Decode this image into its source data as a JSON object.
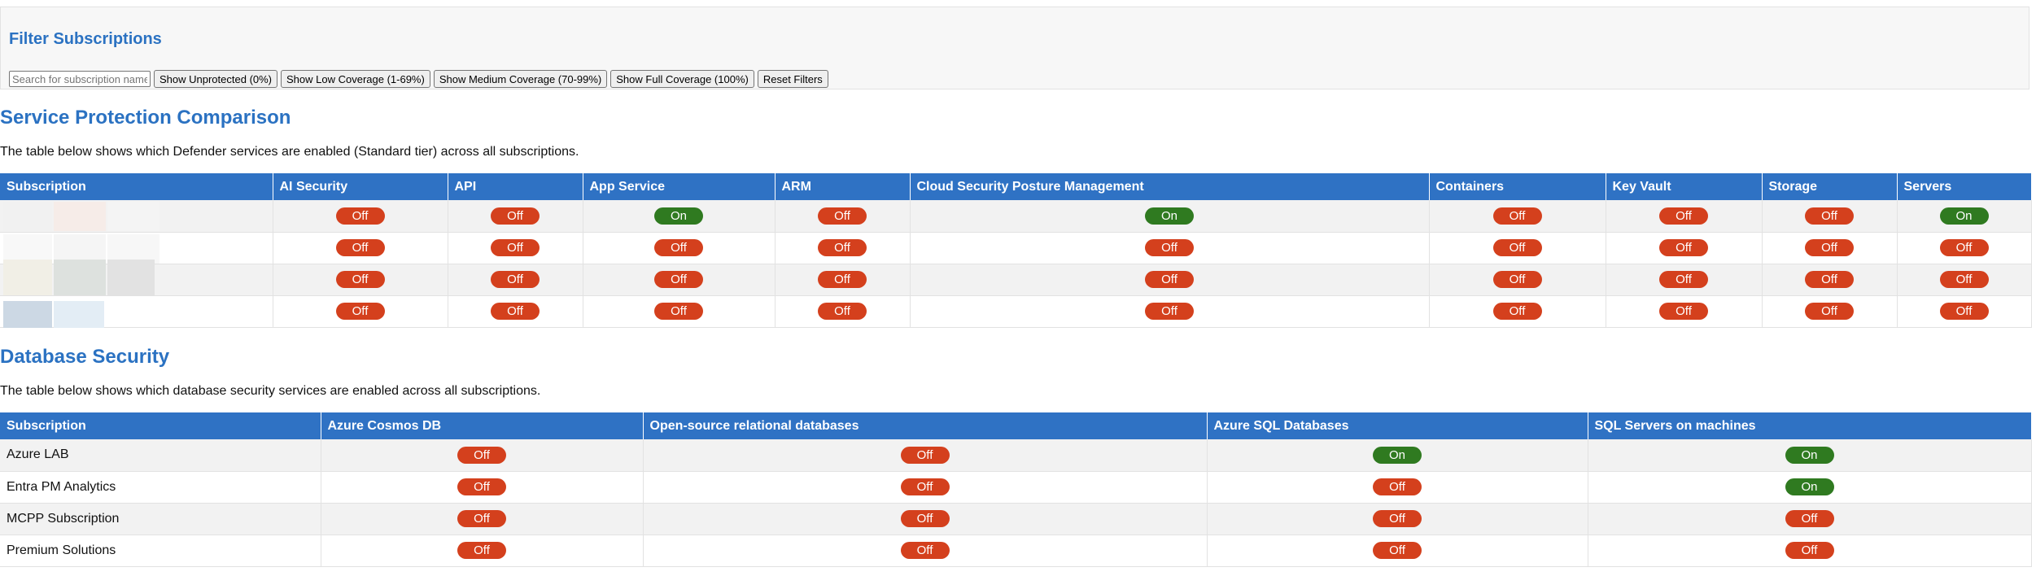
{
  "filter": {
    "title": "Filter Subscriptions",
    "search_placeholder": "Search for subscription name...",
    "buttons": [
      "Show Unprotected (0%)",
      "Show Low Coverage (1-69%)",
      "Show Medium Coverage (70-99%)",
      "Show Full Coverage (100%)",
      "Reset Filters"
    ]
  },
  "service_protection": {
    "title": "Service Protection Comparison",
    "description": "The table below shows which Defender services are enabled (Standard tier) across all subscriptions.",
    "headers": [
      "Subscription",
      "AI Security",
      "API",
      "App Service",
      "ARM",
      "Cloud Security Posture Management",
      "Containers",
      "Key Vault",
      "Storage",
      "Servers"
    ],
    "rows": [
      [
        "Off",
        "Off",
        "On",
        "Off",
        "On",
        "Off",
        "Off",
        "Off",
        "On"
      ],
      [
        "Off",
        "Off",
        "Off",
        "Off",
        "Off",
        "Off",
        "Off",
        "Off",
        "Off"
      ],
      [
        "Off",
        "Off",
        "Off",
        "Off",
        "Off",
        "Off",
        "Off",
        "Off",
        "Off"
      ],
      [
        "Off",
        "Off",
        "Off",
        "Off",
        "Off",
        "Off",
        "Off",
        "Off",
        "Off"
      ]
    ]
  },
  "database_security": {
    "title": "Database Security",
    "description": "The table below shows which database security services are enabled across all subscriptions.",
    "headers": [
      "Subscription",
      "Azure Cosmos DB",
      "Open-source relational databases",
      "Azure SQL Databases",
      "SQL Servers on machines"
    ],
    "rows": [
      {
        "name": "Azure LAB",
        "values": [
          "Off",
          "Off",
          "On",
          "On"
        ]
      },
      {
        "name": "Entra PM Analytics",
        "values": [
          "Off",
          "Off",
          "Off",
          "On"
        ]
      },
      {
        "name": "MCPP Subscription",
        "values": [
          "Off",
          "Off",
          "Off",
          "Off"
        ]
      },
      {
        "name": "Premium Solutions",
        "values": [
          "Off",
          "Off",
          "Off",
          "Off"
        ]
      }
    ]
  },
  "colors": {
    "heading": "#2b72c2",
    "header_bg": "#2f72c4",
    "off": "#d4401d",
    "on": "#2f7a20"
  }
}
